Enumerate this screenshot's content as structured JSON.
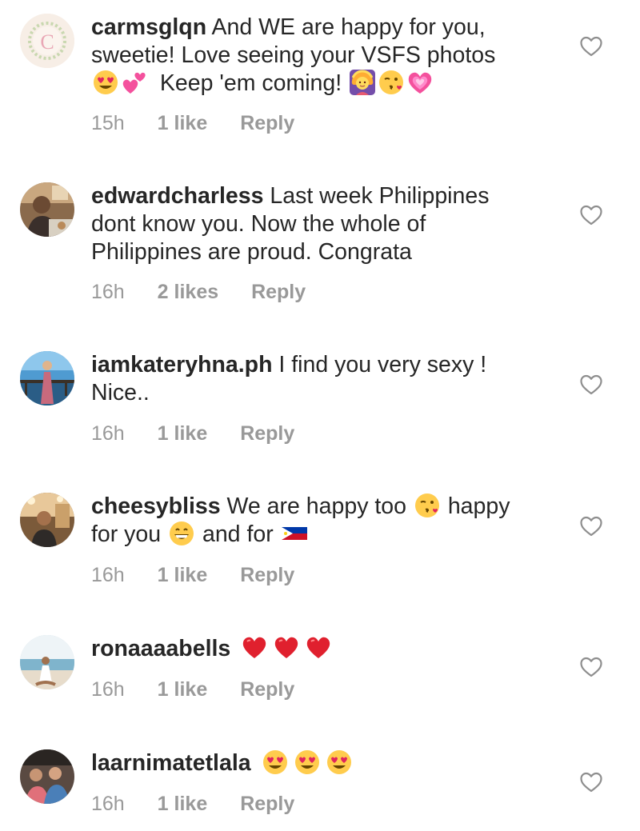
{
  "comments": [
    {
      "username": "carmsglqn",
      "lines": [
        "And WE are happy for you,",
        "sweetie! Love seeing your VSFS photos",
        "Keep 'em coming!"
      ],
      "time": "15h",
      "likes": "1 like",
      "reply": "Reply"
    },
    {
      "username": "edwardcharless",
      "lines": [
        "Last week Philippines",
        "dont know you. Now the whole of",
        "Philippines are proud. Congrata"
      ],
      "time": "16h",
      "likes": "2 likes",
      "reply": "Reply"
    },
    {
      "username": "iamkateryhna.ph",
      "lines": [
        "I find you very sexy !",
        "Nice.."
      ],
      "time": "16h",
      "likes": "1 like",
      "reply": "Reply"
    },
    {
      "username": "cheesybliss",
      "lines": [
        "We are happy too",
        "happy",
        "for you",
        "and for"
      ],
      "time": "16h",
      "likes": "1 like",
      "reply": "Reply"
    },
    {
      "username": "ronaaaabells",
      "lines": [],
      "time": "16h",
      "likes": "1 like",
      "reply": "Reply"
    },
    {
      "username": "laarnimatetlala",
      "lines": [],
      "time": "16h",
      "likes": "1 like",
      "reply": "Reply"
    }
  ],
  "avatar_letter": "C",
  "icons": {
    "like": "heart-outline-icon",
    "emojis": [
      "heart-eyes-emoji",
      "two-hearts-emoji",
      "woman-gesturing-ok-emoji",
      "kissing-face-emoji",
      "growing-heart-emoji",
      "grinning-face-emoji",
      "philippines-flag-emoji",
      "red-heart-emoji"
    ]
  },
  "colors": {
    "text": "#262626",
    "meta": "#999999",
    "background": "#ffffff"
  }
}
